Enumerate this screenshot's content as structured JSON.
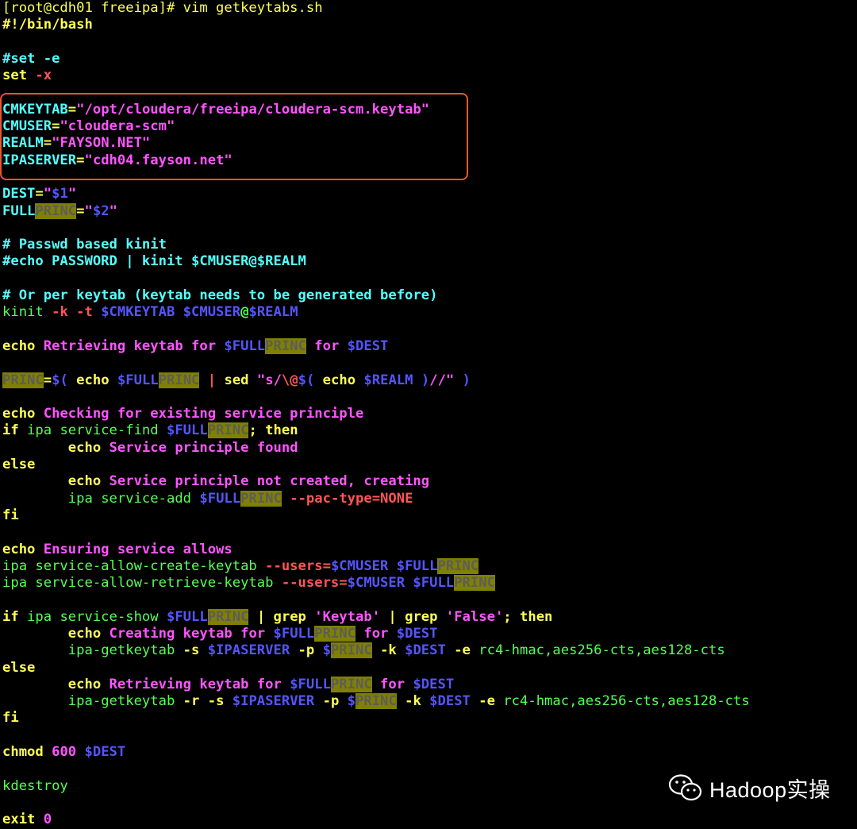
{
  "prompt": "[root@cdh01 freeipa]# vim getkeytabs.sh",
  "code_lines": [
    [
      [
        "keyword",
        "#!/bin/bash"
      ]
    ],
    [],
    [
      [
        "comment",
        "#set -e"
      ]
    ],
    [
      [
        "keyword",
        "set "
      ],
      [
        "flag",
        "-x"
      ]
    ],
    [],
    [
      [
        "var",
        "CMKEYTAB"
      ],
      [
        "eq",
        "="
      ],
      [
        "string",
        "\"/opt/cloudera/freeipa/cloudera-scm.keytab\""
      ]
    ],
    [
      [
        "var",
        "CMUSER"
      ],
      [
        "eq",
        "="
      ],
      [
        "string",
        "\"cloudera-scm\""
      ]
    ],
    [
      [
        "var",
        "REALM"
      ],
      [
        "eq",
        "="
      ],
      [
        "string",
        "\"FAYSON.NET\""
      ]
    ],
    [
      [
        "var",
        "IPASERVER"
      ],
      [
        "eq",
        "="
      ],
      [
        "string",
        "\"cdh04.fayson.net\""
      ]
    ],
    [],
    [
      [
        "var",
        "DEST"
      ],
      [
        "eq",
        "="
      ],
      [
        "string",
        "\""
      ],
      [
        "expand",
        "$1"
      ],
      [
        "string",
        "\""
      ]
    ],
    [
      [
        "var",
        "FULL"
      ],
      [
        "hl",
        "PRINC"
      ],
      [
        "eq",
        "="
      ],
      [
        "string",
        "\""
      ],
      [
        "expand",
        "$2"
      ],
      [
        "string",
        "\""
      ]
    ],
    [],
    [
      [
        "comment",
        "# Passwd based kinit"
      ]
    ],
    [
      [
        "comment",
        "#echo PASSWORD | kinit $CMUSER@$REALM"
      ]
    ],
    [],
    [
      [
        "comment",
        "# Or per keytab (keytab needs to be generated before)"
      ]
    ],
    [
      [
        "cmd",
        "kinit "
      ],
      [
        "flag",
        "-k -t "
      ],
      [
        "expand",
        "$CMKEYTAB $CMUSER"
      ],
      [
        "sym",
        "@"
      ],
      [
        "expand",
        "$REALM"
      ]
    ],
    [],
    [
      [
        "keyword",
        "echo "
      ],
      [
        "string",
        "Retrieving keytab for "
      ],
      [
        "expand",
        "$FULL"
      ],
      [
        "hl",
        "PRINC"
      ],
      [
        "string",
        " for "
      ],
      [
        "expand",
        "$DEST"
      ]
    ],
    [],
    [
      [
        "hl",
        "PRINC"
      ],
      [
        "eq",
        "="
      ],
      [
        "expand",
        "$( "
      ],
      [
        "keyword",
        "echo "
      ],
      [
        "expand",
        "$FULL"
      ],
      [
        "hl",
        "PRINC"
      ],
      [
        "plain",
        " "
      ],
      [
        "flag",
        "|"
      ],
      [
        "keyword",
        " sed "
      ],
      [
        "string",
        "\"s/"
      ],
      [
        "flag",
        "\\@"
      ],
      [
        "expand",
        "$( "
      ],
      [
        "keyword",
        "echo "
      ],
      [
        "expand",
        "$REALM )"
      ],
      [
        "string",
        "//\""
      ],
      [
        "expand",
        " )"
      ]
    ],
    [],
    [
      [
        "keyword",
        "echo "
      ],
      [
        "string",
        "Checking for existing service principle"
      ]
    ],
    [
      [
        "keyword",
        "if "
      ],
      [
        "cmd",
        "ipa service-find "
      ],
      [
        "expand",
        "$FULL"
      ],
      [
        "hl",
        "PRINC"
      ],
      [
        "keyword",
        "; then"
      ]
    ],
    [
      [
        "plain",
        "        "
      ],
      [
        "keyword",
        "echo "
      ],
      [
        "string",
        "Service principle found"
      ]
    ],
    [
      [
        "keyword",
        "else"
      ]
    ],
    [
      [
        "plain",
        "        "
      ],
      [
        "keyword",
        "echo "
      ],
      [
        "string",
        "Service principle not created, creating"
      ]
    ],
    [
      [
        "plain",
        "        "
      ],
      [
        "cmd",
        "ipa service-add "
      ],
      [
        "expand",
        "$FULL"
      ],
      [
        "hl",
        "PRINC"
      ],
      [
        "plain",
        " "
      ],
      [
        "flag",
        "--pac-type=NONE"
      ]
    ],
    [
      [
        "keyword",
        "fi"
      ]
    ],
    [],
    [
      [
        "keyword",
        "echo "
      ],
      [
        "string",
        "Ensuring service allows"
      ]
    ],
    [
      [
        "cmd",
        "ipa service-allow-create-keytab "
      ],
      [
        "flag",
        "--users="
      ],
      [
        "expand",
        "$CMUSER $FULL"
      ],
      [
        "hl",
        "PRINC"
      ]
    ],
    [
      [
        "cmd",
        "ipa service-allow-retrieve-keytab "
      ],
      [
        "flag",
        "--users="
      ],
      [
        "expand",
        "$CMUSER $FULL"
      ],
      [
        "hl",
        "PRINC"
      ]
    ],
    [],
    [
      [
        "keyword",
        "if "
      ],
      [
        "cmd",
        "ipa service-show "
      ],
      [
        "expand",
        "$FULL"
      ],
      [
        "hl",
        "PRINC"
      ],
      [
        "plain",
        " | grep "
      ],
      [
        "string",
        "'Keytab'"
      ],
      [
        "plain",
        " | grep "
      ],
      [
        "string",
        "'False'"
      ],
      [
        "keyword",
        "; then"
      ]
    ],
    [
      [
        "plain",
        "        "
      ],
      [
        "keyword",
        "echo "
      ],
      [
        "string",
        "Creating keytab for "
      ],
      [
        "expand",
        "$FULL"
      ],
      [
        "hl",
        "PRINC"
      ],
      [
        "string",
        " for "
      ],
      [
        "expand",
        "$DEST"
      ]
    ],
    [
      [
        "plain",
        "        "
      ],
      [
        "cmd",
        "ipa-getkeytab "
      ],
      [
        "keyword",
        "-s "
      ],
      [
        "expand",
        "$IPASERVER "
      ],
      [
        "keyword",
        "-p "
      ],
      [
        "expand",
        "$"
      ],
      [
        "hl",
        "PRINC"
      ],
      [
        "plain",
        " "
      ],
      [
        "keyword",
        "-k "
      ],
      [
        "expand",
        "$DEST "
      ],
      [
        "keyword",
        "-e "
      ],
      [
        "cmd",
        "rc4-hmac,aes256-cts,aes128-cts"
      ]
    ],
    [
      [
        "keyword",
        "else"
      ]
    ],
    [
      [
        "plain",
        "        "
      ],
      [
        "keyword",
        "echo "
      ],
      [
        "string",
        "Retrieving keytab for "
      ],
      [
        "expand",
        "$FULL"
      ],
      [
        "hl",
        "PRINC"
      ],
      [
        "string",
        " for "
      ],
      [
        "expand",
        "$DEST"
      ]
    ],
    [
      [
        "plain",
        "        "
      ],
      [
        "cmd",
        "ipa-getkeytab "
      ],
      [
        "keyword",
        "-r -s "
      ],
      [
        "expand",
        "$IPASERVER "
      ],
      [
        "keyword",
        "-p "
      ],
      [
        "expand",
        "$"
      ],
      [
        "hl",
        "PRINC"
      ],
      [
        "plain",
        " "
      ],
      [
        "keyword",
        "-k "
      ],
      [
        "expand",
        "$DEST "
      ],
      [
        "keyword",
        "-e "
      ],
      [
        "cmd",
        "rc4-hmac,aes256-cts,aes128-cts"
      ]
    ],
    [
      [
        "keyword",
        "fi"
      ]
    ],
    [],
    [
      [
        "keyword",
        "chmod "
      ],
      [
        "string",
        "600 "
      ],
      [
        "expand",
        "$DEST"
      ]
    ],
    [],
    [
      [
        "cmd",
        "kdestroy"
      ]
    ],
    [],
    [
      [
        "keyword",
        "exit "
      ],
      [
        "string",
        "0"
      ]
    ]
  ],
  "watermark": {
    "icon": "wechat-icon",
    "text": "Hadoop实操"
  },
  "colors": {
    "background": "#000000",
    "highlight_box": "#e8552d"
  }
}
